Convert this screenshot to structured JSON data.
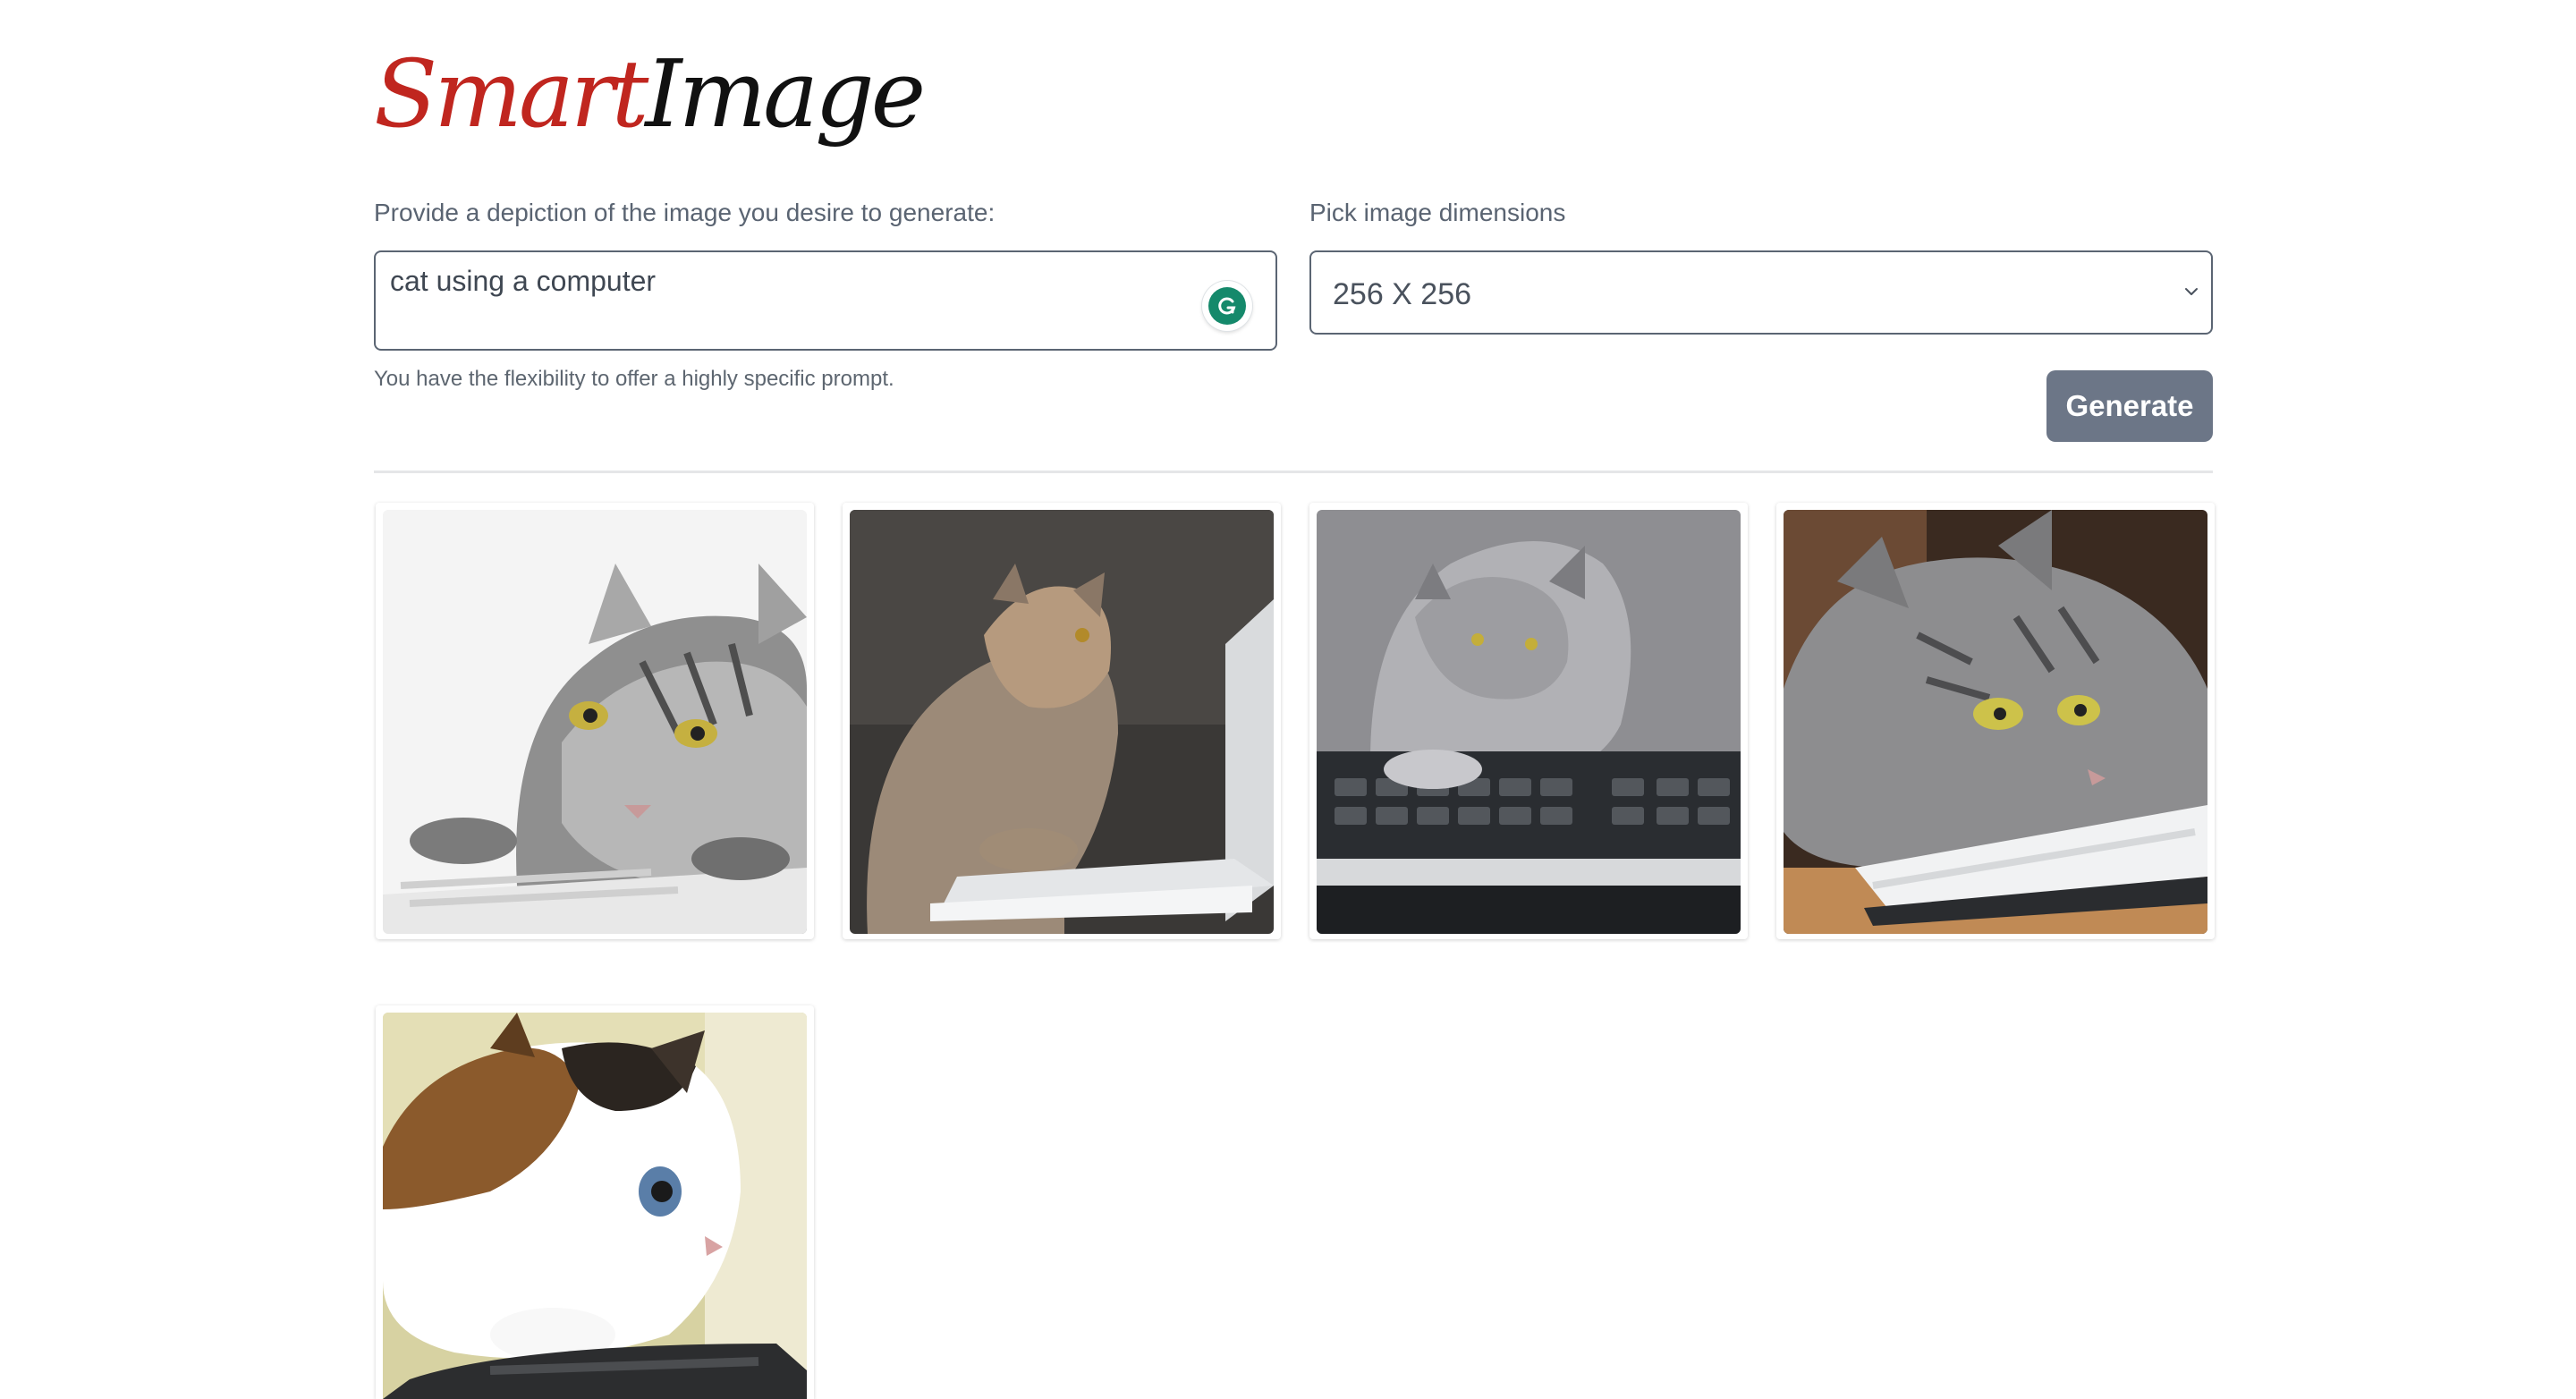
{
  "app": {
    "logo_part1": "Smart",
    "logo_part2": "Image",
    "brand_colors": {
      "smart": "#c0261f",
      "image": "#111111"
    }
  },
  "form": {
    "prompt_label": "Provide a depiction of the image you desire to generate:",
    "prompt_value": "cat using a computer",
    "prompt_helper": "You have the flexibility to offer a highly specific prompt.",
    "dimensions_label": "Pick image dimensions",
    "dimensions_value": "256 X 256",
    "generate_label": "Generate"
  },
  "gallery": {
    "images": [
      {
        "name": "gray tabby cat leaning on white keyboard"
      },
      {
        "name": "fluffy cat looking at white laptop"
      },
      {
        "name": "long-haired gray cat pressing black keyboard"
      },
      {
        "name": "gray tabby resting head on keyboard"
      },
      {
        "name": "calico cat with paws on black keyboard"
      }
    ]
  },
  "icons": {
    "grammarly": "grammarly-icon",
    "select_arrow": "chevron-down-icon"
  }
}
